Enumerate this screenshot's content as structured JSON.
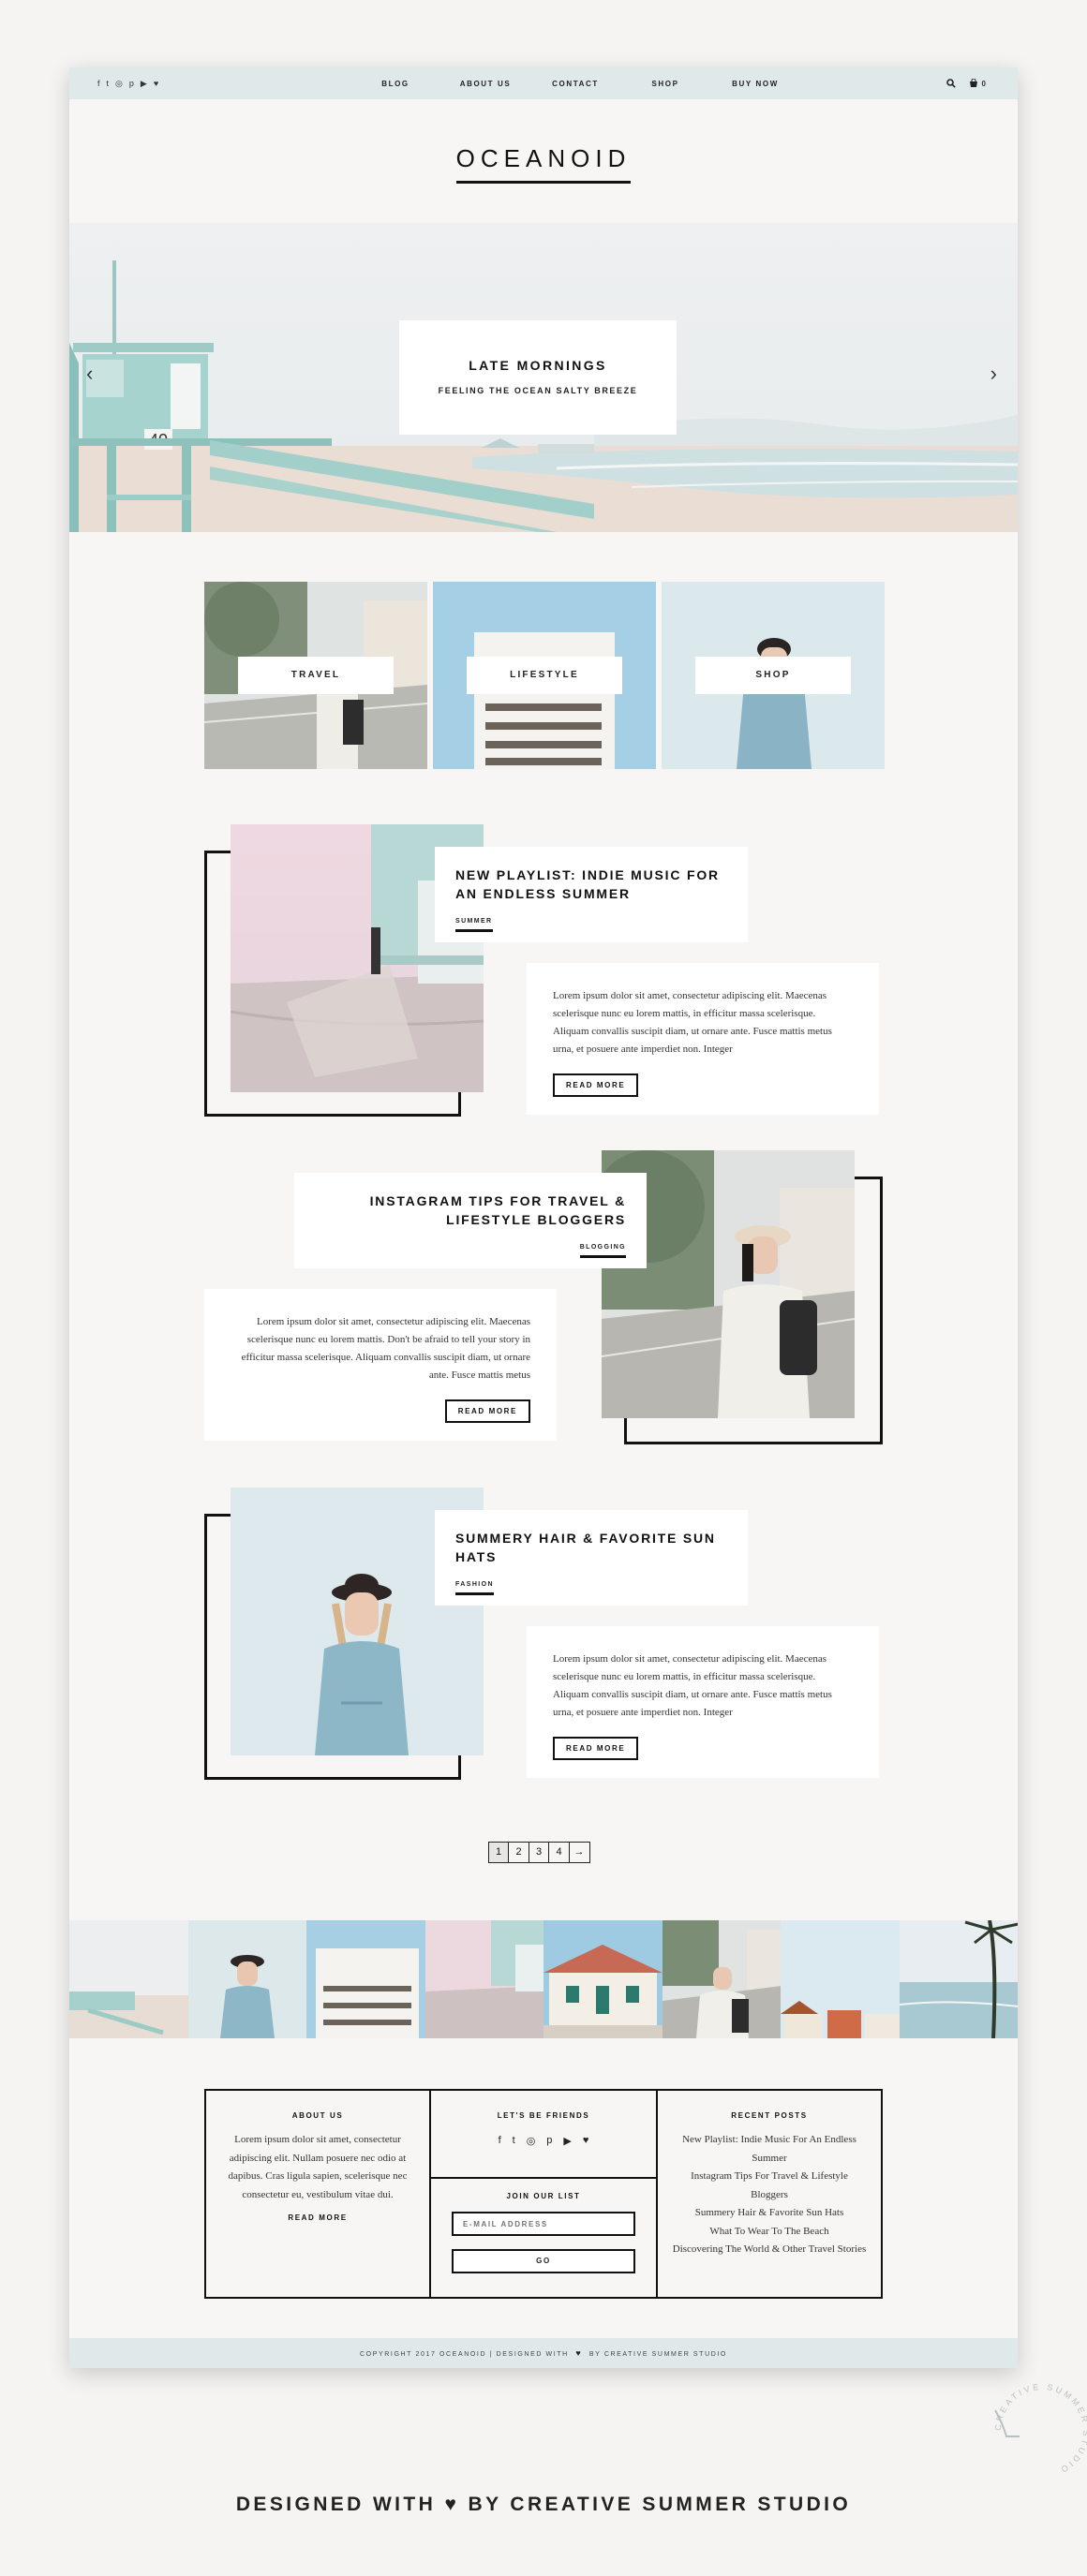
{
  "topbar": {
    "social_icons": [
      "facebook-icon",
      "twitter-icon",
      "instagram-icon",
      "pinterest-icon",
      "youtube-icon",
      "heart-icon"
    ],
    "social_glyphs": [
      "f",
      "t",
      "◎",
      "p",
      "▶",
      "♥"
    ],
    "nav": [
      "BLOG",
      "ABOUT US",
      "CONTACT",
      "SHOP",
      "BUY NOW"
    ],
    "cart_count": "0"
  },
  "logo": "OCEANOID",
  "hero": {
    "title": "LATE MORNINGS",
    "subtitle": "FEELING THE OCEAN SALTY BREEZE",
    "prev": "‹",
    "next": "›"
  },
  "categories": [
    "TRAVEL",
    "LIFESTYLE",
    "SHOP"
  ],
  "posts": [
    {
      "title": "NEW PLAYLIST: INDIE MUSIC FOR AN ENDLESS SUMMER",
      "category": "SUMMER",
      "excerpt": "Lorem ipsum dolor sit amet, consectetur adipiscing elit. Maecenas scelerisque nunc eu lorem mattis, in efficitur massa scelerisque. Aliquam convallis suscipit diam, ut ornare ante. Fusce mattis metus urna, et posuere ante imperdiet non. Integer",
      "button": "READ MORE"
    },
    {
      "title": "INSTAGRAM TIPS FOR TRAVEL & LIFESTYLE BLOGGERS",
      "category": "BLOGGING",
      "excerpt": "Lorem ipsum dolor sit amet, consectetur adipiscing elit. Maecenas scelerisque nunc eu lorem mattis. Don't be afraid to tell your story in efficitur massa scelerisque. Aliquam convallis suscipit diam, ut ornare ante. Fusce mattis metus",
      "button": "READ MORE"
    },
    {
      "title": "SUMMERY HAIR & FAVORITE SUN HATS",
      "category": "FASHION",
      "excerpt": "Lorem ipsum dolor sit amet, consectetur adipiscing elit. Maecenas scelerisque nunc eu lorem mattis, in efficitur massa scelerisque. Aliquam convallis suscipit diam, ut ornare ante. Fusce mattis metus urna, et posuere ante imperdiet non. Integer",
      "button": "READ MORE"
    }
  ],
  "pagination": [
    "1",
    "2",
    "3",
    "4",
    "→"
  ],
  "footer": {
    "about": {
      "heading": "ABOUT US",
      "text": "Lorem ipsum dolor sit amet, consectetur adipiscing elit. Nullam posuere nec odio at dapibus. Cras ligula sapien, scelerisque nec consectetur eu, vestibulum vitae dui.",
      "link": "READ MORE"
    },
    "friends": {
      "heading": "LET'S BE FRIENDS",
      "icons": [
        "f",
        "t",
        "◎",
        "p",
        "▶",
        "♥"
      ]
    },
    "newsletter": {
      "heading": "JOIN OUR LIST",
      "placeholder": "E-MAIL ADDRESS",
      "button": "GO"
    },
    "recent": {
      "heading": "RECENT POSTS",
      "items": [
        "New Playlist: Indie Music For An Endless Summer",
        "Instagram Tips For Travel & Lifestyle Bloggers",
        "Summery Hair & Favorite Sun Hats",
        "What To Wear To The Beach",
        "Discovering The World & Other Travel Stories"
      ]
    }
  },
  "copyright_left": "COPYRIGHT 2017 OCEANOID | DESIGNED WITH",
  "copyright_heart": "♥",
  "copyright_right": "BY CREATIVE SUMMER STUDIO",
  "tagline": "DESIGNED WITH ♥ BY CREATIVE SUMMER STUDIO",
  "stamp_text": "CREATIVE SUMMER STUDIO"
}
